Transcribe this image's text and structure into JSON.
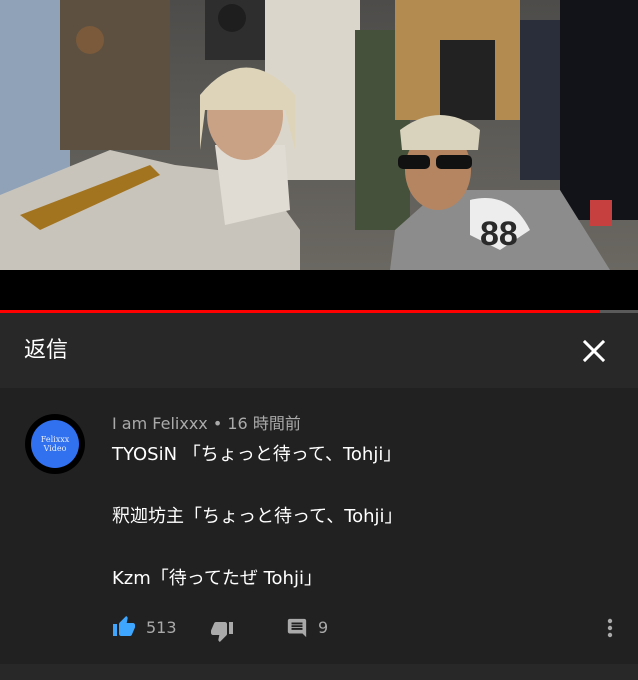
{
  "video": {
    "progress_fraction": 0.94,
    "progress_color": "#ff0000"
  },
  "panel": {
    "title": "返信",
    "close_icon": "close-icon"
  },
  "comment": {
    "avatar": {
      "line1": "Felixxx",
      "line2": "Video",
      "color": "#3170ee"
    },
    "author": "I am Felixxx",
    "separator": "•",
    "time": "16 時間前",
    "lines": [
      "TYOSiN 「ちょっと待って、Tohji」",
      "釈迦坊主「ちょっと待って、Tohji」",
      "Kzm「待ってたぜ Tohji」"
    ],
    "likes": "513",
    "replies": "9",
    "icons": {
      "like": "thumbs-up-icon",
      "dislike": "thumbs-down-icon",
      "reply": "comment-icon",
      "more": "more-vert-icon"
    },
    "like_color": "#3ea6ff"
  }
}
